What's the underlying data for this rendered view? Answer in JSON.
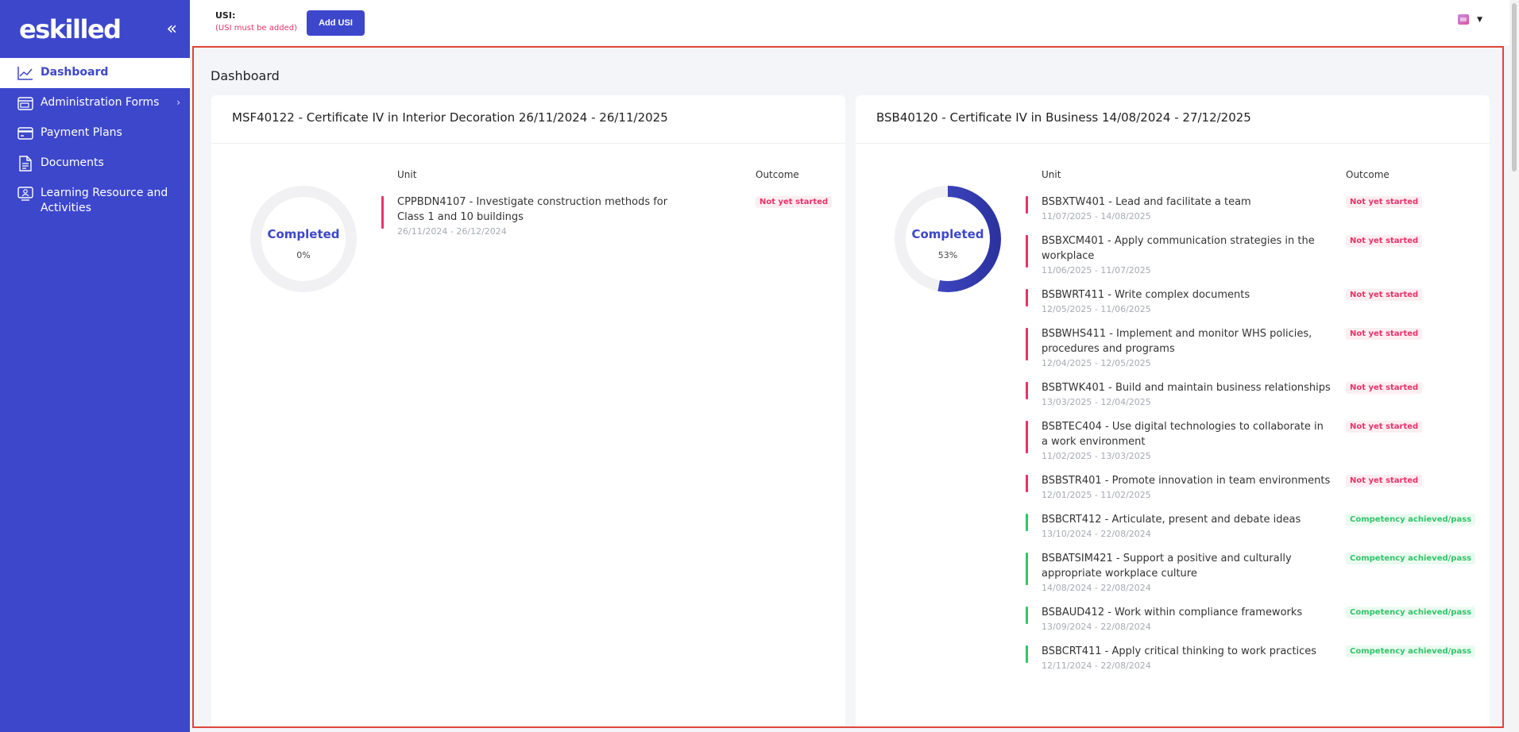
{
  "app": {
    "logo": "eskilled"
  },
  "sidebar": {
    "collapse_glyph": "«",
    "items": [
      {
        "label": "Dashboard",
        "icon": "chart-line-icon",
        "active": true
      },
      {
        "label": "Administration Forms",
        "icon": "browser-icon",
        "has_chevron": true
      },
      {
        "label": "Payment Plans",
        "icon": "credit-card-icon"
      },
      {
        "label": "Documents",
        "icon": "document-icon"
      },
      {
        "label": "Learning Resource and Activities",
        "icon": "presentation-icon"
      }
    ]
  },
  "topbar": {
    "usi_label": "USI:",
    "usi_note": "(USI must be added)",
    "add_usi_label": "Add USI"
  },
  "page": {
    "title": "Dashboard"
  },
  "courses": [
    {
      "title": "MSF40122 - Certificate IV in Interior Decoration 26/11/2024 - 26/11/2025",
      "donut_label": "Completed",
      "percent_text": "0%",
      "percent": 0,
      "unit_header": "Unit",
      "outcome_header": "Outcome",
      "units": [
        {
          "name": "CPPBDN4107 - Investigate construction methods for Class 1 and 10 buildings",
          "dates": "26/11/2024 - 26/12/2024",
          "outcome": "Not yet started",
          "status": "ns"
        }
      ]
    },
    {
      "title": "BSB40120 - Certificate IV in Business 14/08/2024 - 27/12/2025",
      "donut_label": "Completed",
      "percent_text": "53%",
      "percent": 53,
      "unit_header": "Unit",
      "outcome_header": "Outcome",
      "units": [
        {
          "name": "BSBXTW401 - Lead and facilitate a team",
          "dates": "11/07/2025 - 14/08/2025",
          "outcome": "Not yet started",
          "status": "ns"
        },
        {
          "name": "BSBXCM401 - Apply communication strategies in the workplace",
          "dates": "11/06/2025 - 11/07/2025",
          "outcome": "Not yet started",
          "status": "ns"
        },
        {
          "name": "BSBWRT411 - Write complex documents",
          "dates": "12/05/2025 - 11/06/2025",
          "outcome": "Not yet started",
          "status": "ns"
        },
        {
          "name": "BSBWHS411 - Implement and monitor WHS policies, procedures and programs",
          "dates": "12/04/2025 - 12/05/2025",
          "outcome": "Not yet started",
          "status": "ns"
        },
        {
          "name": "BSBTWK401 - Build and maintain business relationships",
          "dates": "13/03/2025 - 12/04/2025",
          "outcome": "Not yet started",
          "status": "ns"
        },
        {
          "name": "BSBTEC404 - Use digital technologies to collaborate in a work environment",
          "dates": "11/02/2025 - 13/03/2025",
          "outcome": "Not yet started",
          "status": "ns"
        },
        {
          "name": "BSBSTR401 - Promote innovation in team environments",
          "dates": "12/01/2025 - 11/02/2025",
          "outcome": "Not yet started",
          "status": "ns"
        },
        {
          "name": "BSBCRT412 - Articulate, present and debate ideas",
          "dates": "13/10/2024 - 22/08/2024",
          "outcome": "Competency achieved/pass",
          "status": "pass"
        },
        {
          "name": "BSBATSIM421 - Support a positive and culturally appropriate workplace culture",
          "dates": "14/08/2024 - 22/08/2024",
          "outcome": "Competency achieved/pass",
          "status": "pass"
        },
        {
          "name": "BSBAUD412 - Work within compliance frameworks",
          "dates": "13/09/2024 - 22/08/2024",
          "outcome": "Competency achieved/pass",
          "status": "pass"
        },
        {
          "name": "BSBCRT411 - Apply critical thinking to work practices",
          "dates": "12/11/2024 - 22/08/2024",
          "outcome": "Competency achieved/pass",
          "status": "pass"
        }
      ]
    }
  ],
  "colors": {
    "brand": "#3d47cc",
    "not_started": "#e8336b",
    "pass": "#33c46b",
    "highlight_frame": "#e0453a"
  }
}
